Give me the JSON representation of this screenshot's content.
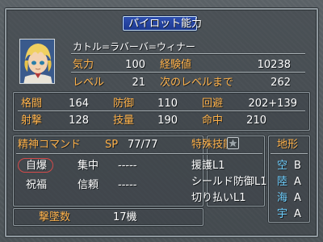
{
  "title": "パイロット能力",
  "pilot": {
    "name": "カトル=ラバーバ=ウィナー",
    "kiryoku_label": "気力",
    "kiryoku": "100",
    "exp_label": "経験値",
    "exp": "10238",
    "level_label": "レベル",
    "level": "21",
    "next_label": "次のレベルまで",
    "next": "262"
  },
  "stats": {
    "kakutou_label": "格闘",
    "kakutou": "164",
    "bougyo_label": "防御",
    "bougyo": "110",
    "kaihi_label": "回避",
    "kaihi": "202+139",
    "shageki_label": "射撃",
    "shageki": "128",
    "giryou_label": "技量",
    "giryou": "190",
    "meichu_label": "命中",
    "meichu": "210"
  },
  "seishin": {
    "header": "精神コマンド",
    "sp_label": "SP",
    "sp": "77/77",
    "commands": [
      {
        "name": "自爆"
      },
      {
        "name": "集中"
      },
      {
        "name": "-----"
      },
      {
        "name": "祝福"
      },
      {
        "name": "信頼"
      },
      {
        "name": "-----"
      }
    ]
  },
  "skills": {
    "header": "特殊技能",
    "icon": "star-icon",
    "items": [
      "援護L1",
      "シールド防御L1",
      "切り払いL1"
    ]
  },
  "terrain": {
    "header": "地形",
    "rows": [
      {
        "type": "空",
        "rank": "B"
      },
      {
        "type": "陸",
        "rank": "A"
      },
      {
        "type": "海",
        "rank": "A"
      },
      {
        "type": "宇",
        "rank": "A"
      }
    ]
  },
  "kills": {
    "label": "撃墜数",
    "value": "17機"
  },
  "colors": {
    "label": "#ffb24a",
    "value": "#ffffff",
    "terrain_type": "#6fd0ff",
    "title_bg": "#2340a0",
    "highlight": "#d24a4a"
  }
}
